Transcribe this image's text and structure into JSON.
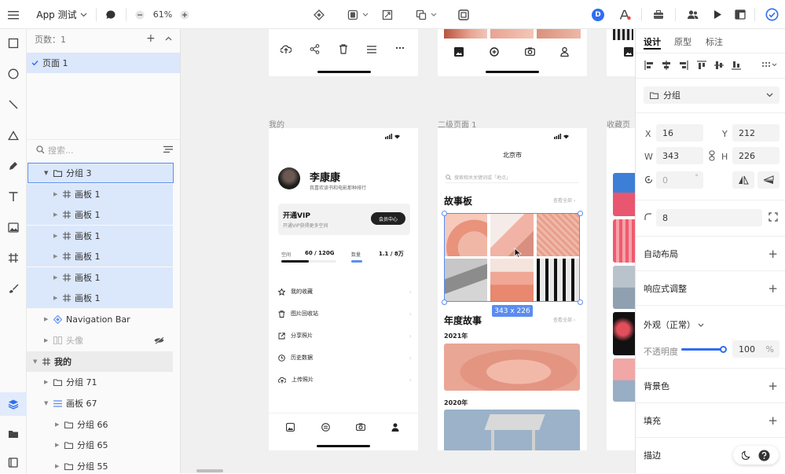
{
  "topbar": {
    "app_name": "App 测试",
    "zoom": "61%",
    "user_initial": "D"
  },
  "layers_panel": {
    "pages_label": "页数：1",
    "page_item": "页面 1",
    "search_placeholder": "搜索...",
    "items": [
      {
        "label": "分组 3"
      },
      {
        "label": "画板 1"
      },
      {
        "label": "画板 1"
      },
      {
        "label": "画板 1"
      },
      {
        "label": "画板 1"
      },
      {
        "label": "画板 1"
      },
      {
        "label": "画板 1"
      },
      {
        "label": "Navigation Bar"
      },
      {
        "label": "头像"
      },
      {
        "label": "我的"
      },
      {
        "label": "分组 71"
      },
      {
        "label": "画板 67"
      },
      {
        "label": "分组 66"
      },
      {
        "label": "分组 65"
      },
      {
        "label": "分组 55"
      }
    ]
  },
  "canvas": {
    "artboard_labels": [
      "我的",
      "二级页面 1",
      "收藏页"
    ],
    "selection_size": "343 x 226",
    "profile": {
      "name": "李康康",
      "bio": "我喜欢读书和电影那种排行",
      "vip_title": "开通VIP",
      "vip_sub": "开通VIP获得更多空间",
      "vip_button": "会员中心",
      "space_label": "空间",
      "space_value": "60 / 120G",
      "count_label": "数量",
      "count_value": "1.1 / 8万",
      "menu": [
        "我的收藏",
        "图片回收站",
        "分享照片",
        "历史数据",
        "上传照片"
      ]
    },
    "story": {
      "city": "北京市",
      "search_placeholder": "搜索相关关键词或「地点」",
      "section1": "故事板",
      "section2": "年度故事",
      "view_all": "查看全部 ›",
      "year1": "2021年",
      "year2": "2020年"
    }
  },
  "properties": {
    "tabs": [
      "设计",
      "原型",
      "标注"
    ],
    "type_label": "分组",
    "x_label": "X",
    "x": "16",
    "y_label": "Y",
    "y": "212",
    "w_label": "W",
    "w": "343",
    "h_label": "H",
    "h": "226",
    "rotation": "0",
    "rotation_unit": "°",
    "radius": "8",
    "auto_layout": "自动布局",
    "responsive": "响应式调整",
    "appearance": "外观（正常）",
    "opacity_label": "不透明度",
    "opacity": "100",
    "opacity_unit": "%",
    "opacity_value": 1.0,
    "background": "背景色",
    "fill": "填充",
    "stroke": "描边"
  },
  "colors": {
    "accent": "#2f6df2",
    "selection": "#5b8def"
  }
}
